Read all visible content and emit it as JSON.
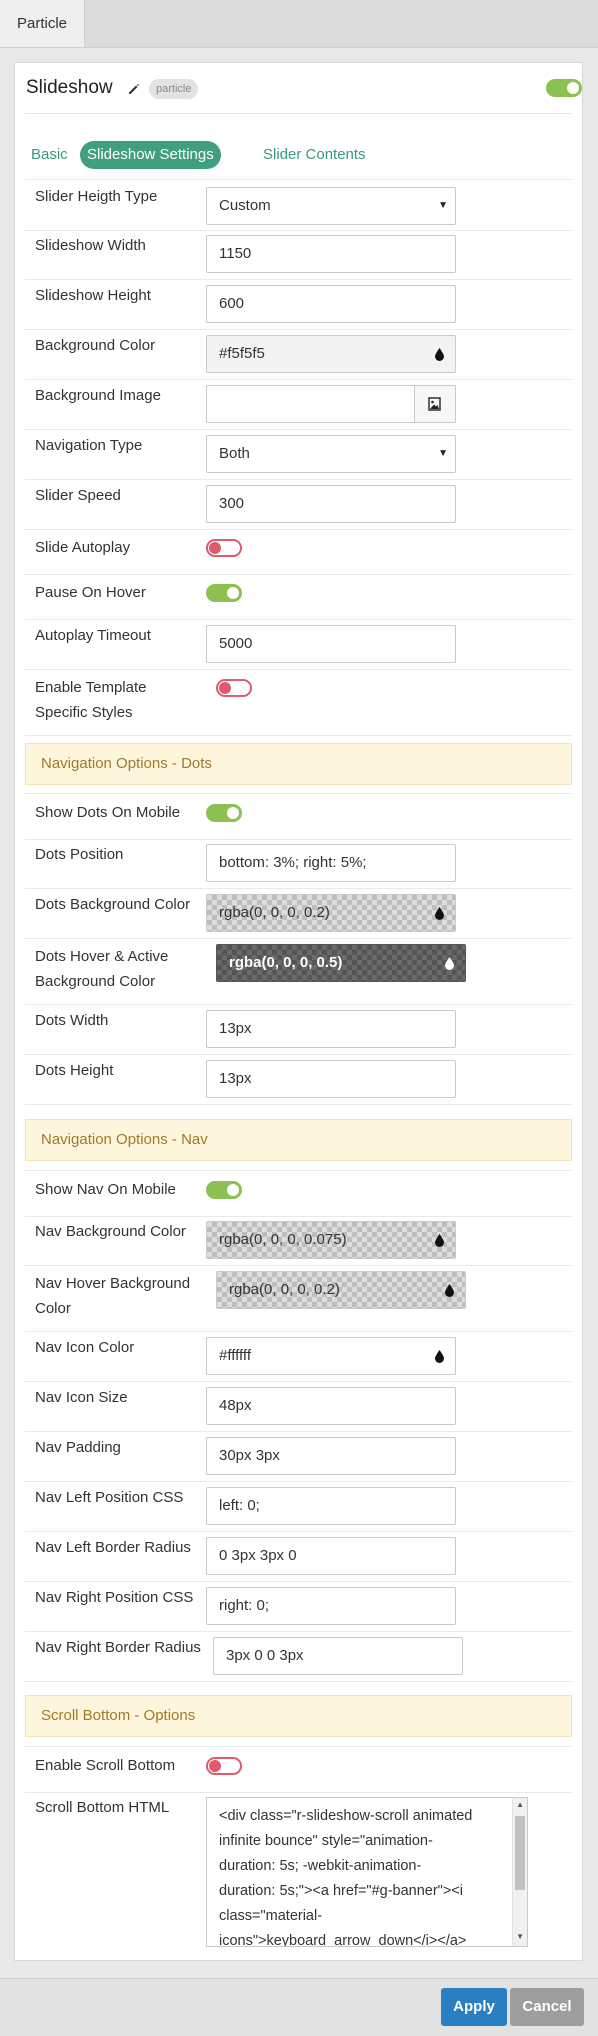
{
  "top_tab": "Particle",
  "header": {
    "title": "Slideshow",
    "badge": "particle",
    "enabled": true
  },
  "tabs": [
    "Basic",
    "Slideshow Settings",
    "Slider Contents"
  ],
  "rows": [
    {
      "label": "Slider Heigth Type",
      "value": "Custom"
    },
    {
      "label": "Slideshow Width",
      "value": "1150"
    },
    {
      "label": "Slideshow Height",
      "value": "600"
    },
    {
      "label": "Background Color",
      "value": "#f5f5f5"
    },
    {
      "label": "Background Image",
      "value": ""
    },
    {
      "label": "Navigation Type",
      "value": "Both"
    },
    {
      "label": "Slider Speed",
      "value": "300"
    },
    {
      "label": "Slide Autoplay",
      "value": false
    },
    {
      "label": "Pause On Hover",
      "value": true
    },
    {
      "label": "Autoplay Timeout",
      "value": "5000"
    },
    {
      "label": "Enable Template\nSpecific Styles",
      "value": false
    },
    {
      "label": "Show Dots On Mobile",
      "value": true
    },
    {
      "label": "Dots Position",
      "value": "bottom: 3%; right: 5%;"
    },
    {
      "label": "Dots Background Color",
      "value": "rgba(0, 0, 0, 0.2)"
    },
    {
      "label": "Dots Hover & Active\nBackground Color",
      "value": "rgba(0, 0, 0, 0.5)"
    },
    {
      "label": "Dots Width",
      "value": "13px"
    },
    {
      "label": "Dots Height",
      "value": "13px"
    },
    {
      "label": "Show Nav On Mobile",
      "value": true
    },
    {
      "label": "Nav Background Color",
      "value": "rgba(0, 0, 0, 0.075)"
    },
    {
      "label": "Nav Hover Background\nColor",
      "value": "rgba(0, 0, 0, 0.2)"
    },
    {
      "label": "Nav Icon Color",
      "value": "#ffffff"
    },
    {
      "label": "Nav Icon Size",
      "value": "48px"
    },
    {
      "label": "Nav Padding",
      "value": "30px 3px"
    },
    {
      "label": "Nav Left Position CSS",
      "value": "left: 0;"
    },
    {
      "label": "Nav Left Border Radius",
      "value": "0 3px 3px 0"
    },
    {
      "label": "Nav Right Position CSS",
      "value": "right: 0;"
    },
    {
      "label": "Nav Right Border Radius",
      "value": "3px 0 0 3px"
    },
    {
      "label": "Enable Scroll Bottom",
      "value": false
    },
    {
      "label": "Scroll Bottom HTML",
      "value": "<div class=\"r-slideshow-scroll animated\ninfinite bounce\" style=\"animation-\nduration: 5s; -webkit-animation-\nduration: 5s;\"><a href=\"#g-banner\"><i\nclass=\"material-\nicons\">keyboard_arrow_down</i></a>"
    }
  ],
  "sections": [
    "Navigation Options - Dots",
    "Navigation Options - Nav",
    "Scroll Bottom - Options"
  ],
  "footer": {
    "apply": "Apply",
    "cancel": "Cancel"
  },
  "colors": {
    "accent": "#3f9f7e",
    "toggle_on": "#8cc152",
    "toggle_off": "#e05a6d",
    "apply": "#2a7ec2"
  }
}
